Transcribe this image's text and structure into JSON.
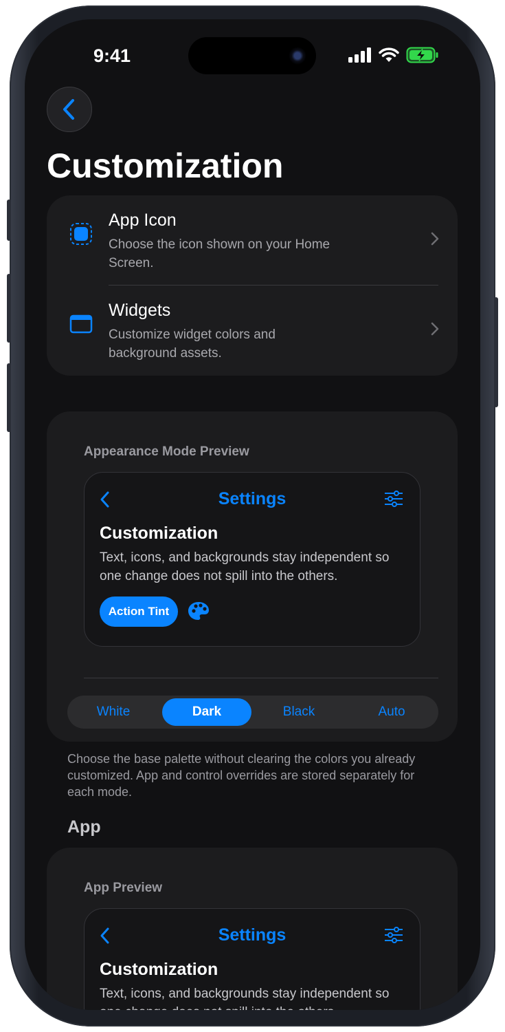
{
  "status_bar": {
    "time": "9:41"
  },
  "nav": {
    "title": "Customization"
  },
  "menu": {
    "items": [
      {
        "title": "App Icon",
        "description": "Choose the icon shown on your Home Screen."
      },
      {
        "title": "Widgets",
        "description": "Customize widget colors and background assets."
      }
    ]
  },
  "appearance": {
    "section_label": "Appearance Mode Preview",
    "preview": {
      "nav_title": "Settings",
      "heading": "Customization",
      "body": "Text, icons, and backgrounds stay independent so one change does not spill into the others.",
      "pill_label": "Action Tint"
    },
    "modes": [
      "White",
      "Dark",
      "Black",
      "Auto"
    ],
    "selected_mode": "Dark",
    "footnote": "Choose the base palette without clearing the colors you already customized. App and control overrides are stored separately for each mode."
  },
  "app_section": {
    "title": "App",
    "section_label": "App Preview",
    "preview": {
      "nav_title": "Settings",
      "heading": "Customization",
      "body": "Text, icons, and backgrounds stay independent so one change does not spill into the others."
    }
  },
  "colors": {
    "accent": "#0a84ff",
    "background": "#111113",
    "card": "#1c1c1e",
    "battery": "#32d74b"
  }
}
